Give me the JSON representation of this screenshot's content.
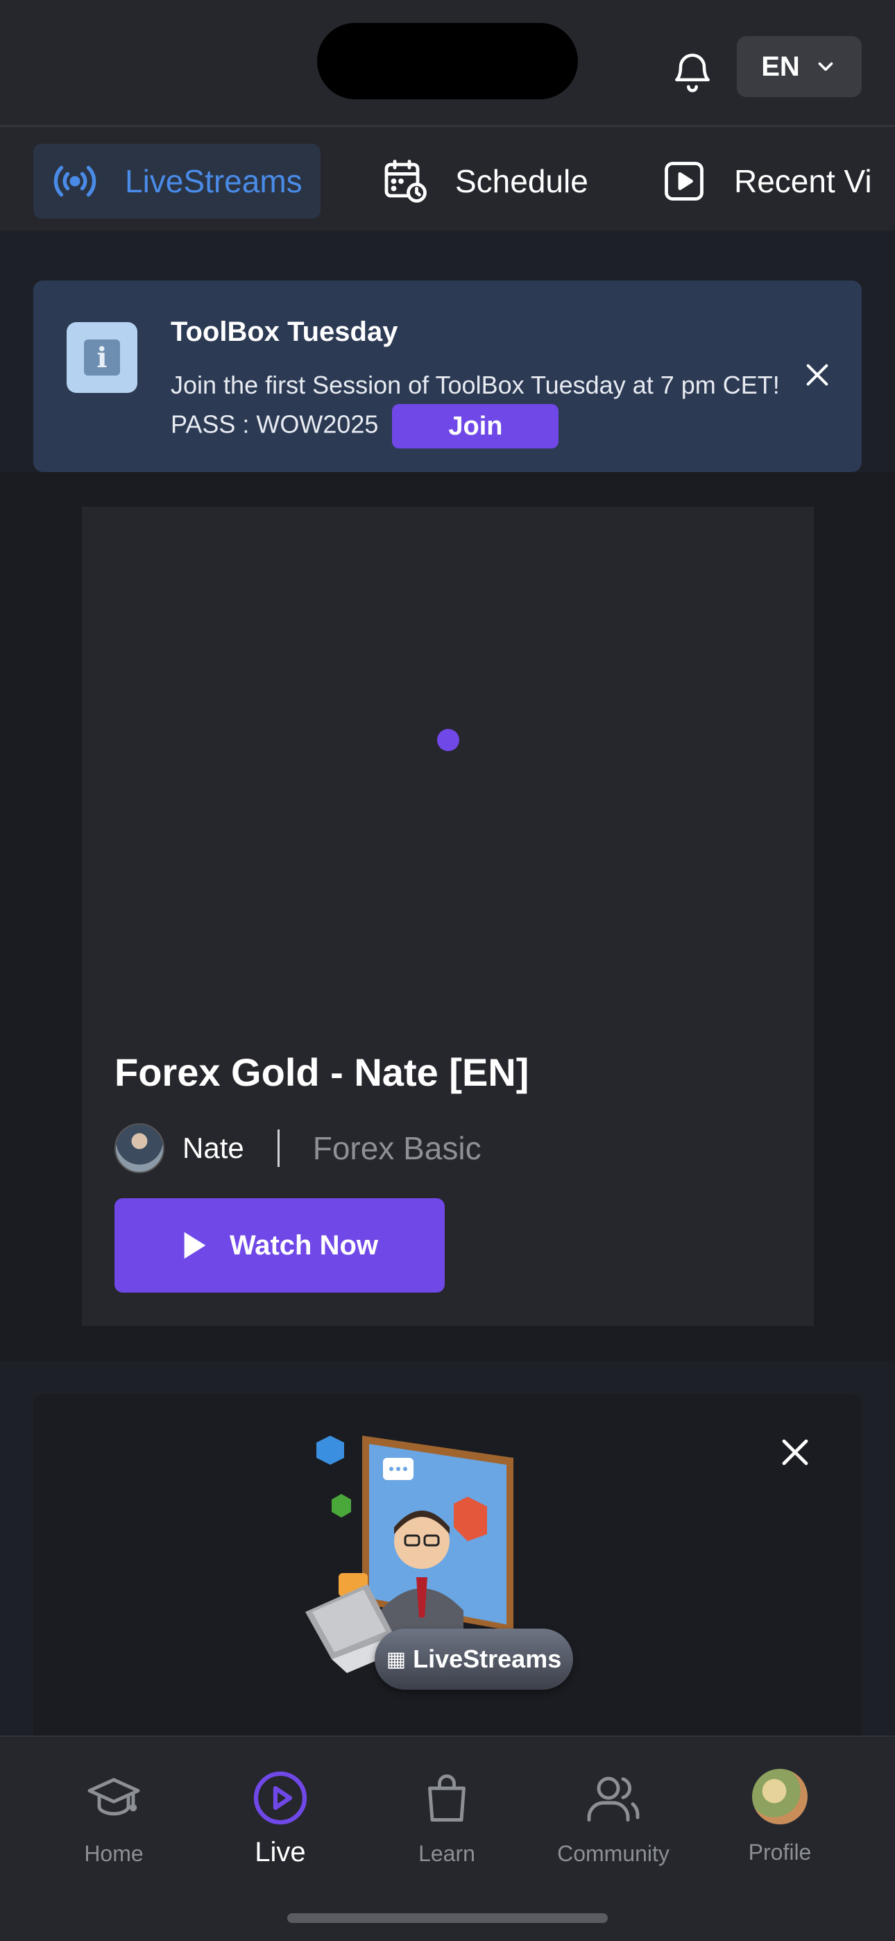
{
  "header": {
    "language": "EN"
  },
  "tabs": [
    {
      "label": "LiveStreams",
      "icon": "broadcast-icon",
      "active": true
    },
    {
      "label": "Schedule",
      "icon": "calendar-clock-icon",
      "active": false
    },
    {
      "label": "Recent Vi",
      "icon": "play-square-icon",
      "active": false
    }
  ],
  "banner": {
    "title": "ToolBox Tuesday",
    "message": "Join the first Session of ToolBox Tuesday at 7 pm CET! PASS : WOW2025",
    "join_label": "Join",
    "icon": "info-icon"
  },
  "live_card": {
    "title": "Forex Gold - Nate [EN]",
    "host": "Nate",
    "category": "Forex Basic",
    "watch_label": "Watch Now"
  },
  "promo": {
    "pill_label": "LiveStreams"
  },
  "bottom_nav": [
    {
      "label": "Home",
      "icon": "graduation-cap-icon",
      "active": false
    },
    {
      "label": "Live",
      "icon": "play-circle-icon",
      "active": true
    },
    {
      "label": "Learn",
      "icon": "shopping-bag-icon",
      "active": false
    },
    {
      "label": "Community",
      "icon": "users-icon",
      "active": false
    },
    {
      "label": "Profile",
      "icon": "profile-avatar",
      "active": false
    }
  ],
  "colors": {
    "accent": "#7048e8",
    "active_tab": "#4a8be8",
    "background": "#1e2027",
    "banner": "#2c3a54"
  }
}
